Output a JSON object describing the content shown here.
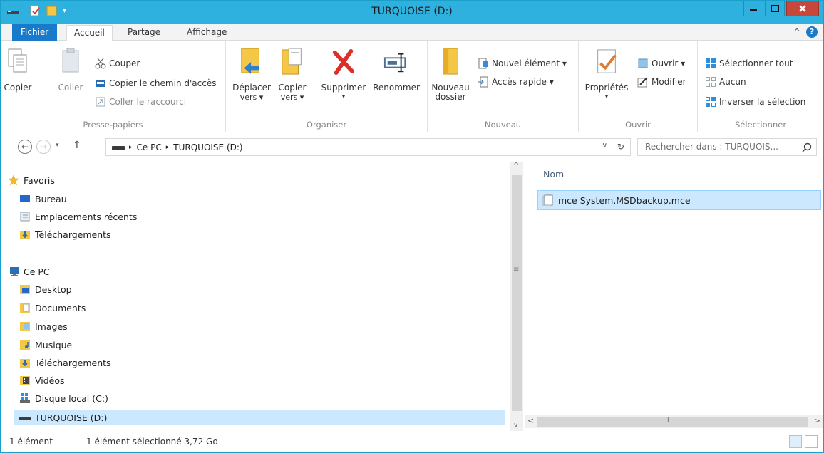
{
  "window": {
    "title": "TURQUOISE (D:)"
  },
  "ribbon_tabs": {
    "file": "Fichier",
    "home": "Accueil",
    "share": "Partage",
    "view": "Affichage"
  },
  "ribbon": {
    "clipboard": {
      "label": "Presse-papiers",
      "copy": "Copier",
      "paste": "Coller",
      "cut": "Couper",
      "copy_path": "Copier le chemin d'accès",
      "paste_shortcut": "Coller le raccourci"
    },
    "organize": {
      "label": "Organiser",
      "move_to_1": "Déplacer",
      "move_to_2": "vers ▾",
      "copy_to_1": "Copier",
      "copy_to_2": "vers ▾",
      "delete": "Supprimer",
      "rename": "Renommer"
    },
    "new": {
      "label": "Nouveau",
      "new_folder_1": "Nouveau",
      "new_folder_2": "dossier",
      "new_item": "Nouvel élément ▾",
      "easy_access": "Accès rapide ▾"
    },
    "open": {
      "label": "Ouvrir",
      "properties": "Propriétés",
      "open": "Ouvrir ▾",
      "edit": "Modifier"
    },
    "select": {
      "label": "Sélectionner",
      "select_all": "Sélectionner tout",
      "select_none": "Aucun",
      "invert": "Inverser la sélection"
    }
  },
  "address": {
    "crumb_pc": "Ce PC",
    "crumb_drive": "TURQUOISE (D:)",
    "search_placeholder": "Rechercher dans : TURQUOIS..."
  },
  "nav": {
    "favorites": "Favoris",
    "desktop_fav": "Bureau",
    "recent": "Emplacements récents",
    "downloads_fav": "Téléchargements",
    "this_pc": "Ce PC",
    "desktop": "Desktop",
    "documents": "Documents",
    "images": "Images",
    "music": "Musique",
    "downloads": "Téléchargements",
    "videos": "Vidéos",
    "local_disk": "Disque local (C:)",
    "turquoise": "TURQUOISE (D:)"
  },
  "content": {
    "column_name": "Nom",
    "files": [
      {
        "name": "mce System.MSDbackup.mce"
      }
    ]
  },
  "status": {
    "count": "1 élément",
    "selection": "1 élément sélectionné 3,72 Go"
  },
  "colors": {
    "titlebar": "#2fb1e0",
    "file_tab": "#1979ca",
    "selection": "#cce8ff",
    "close_button": "#c7483a"
  }
}
